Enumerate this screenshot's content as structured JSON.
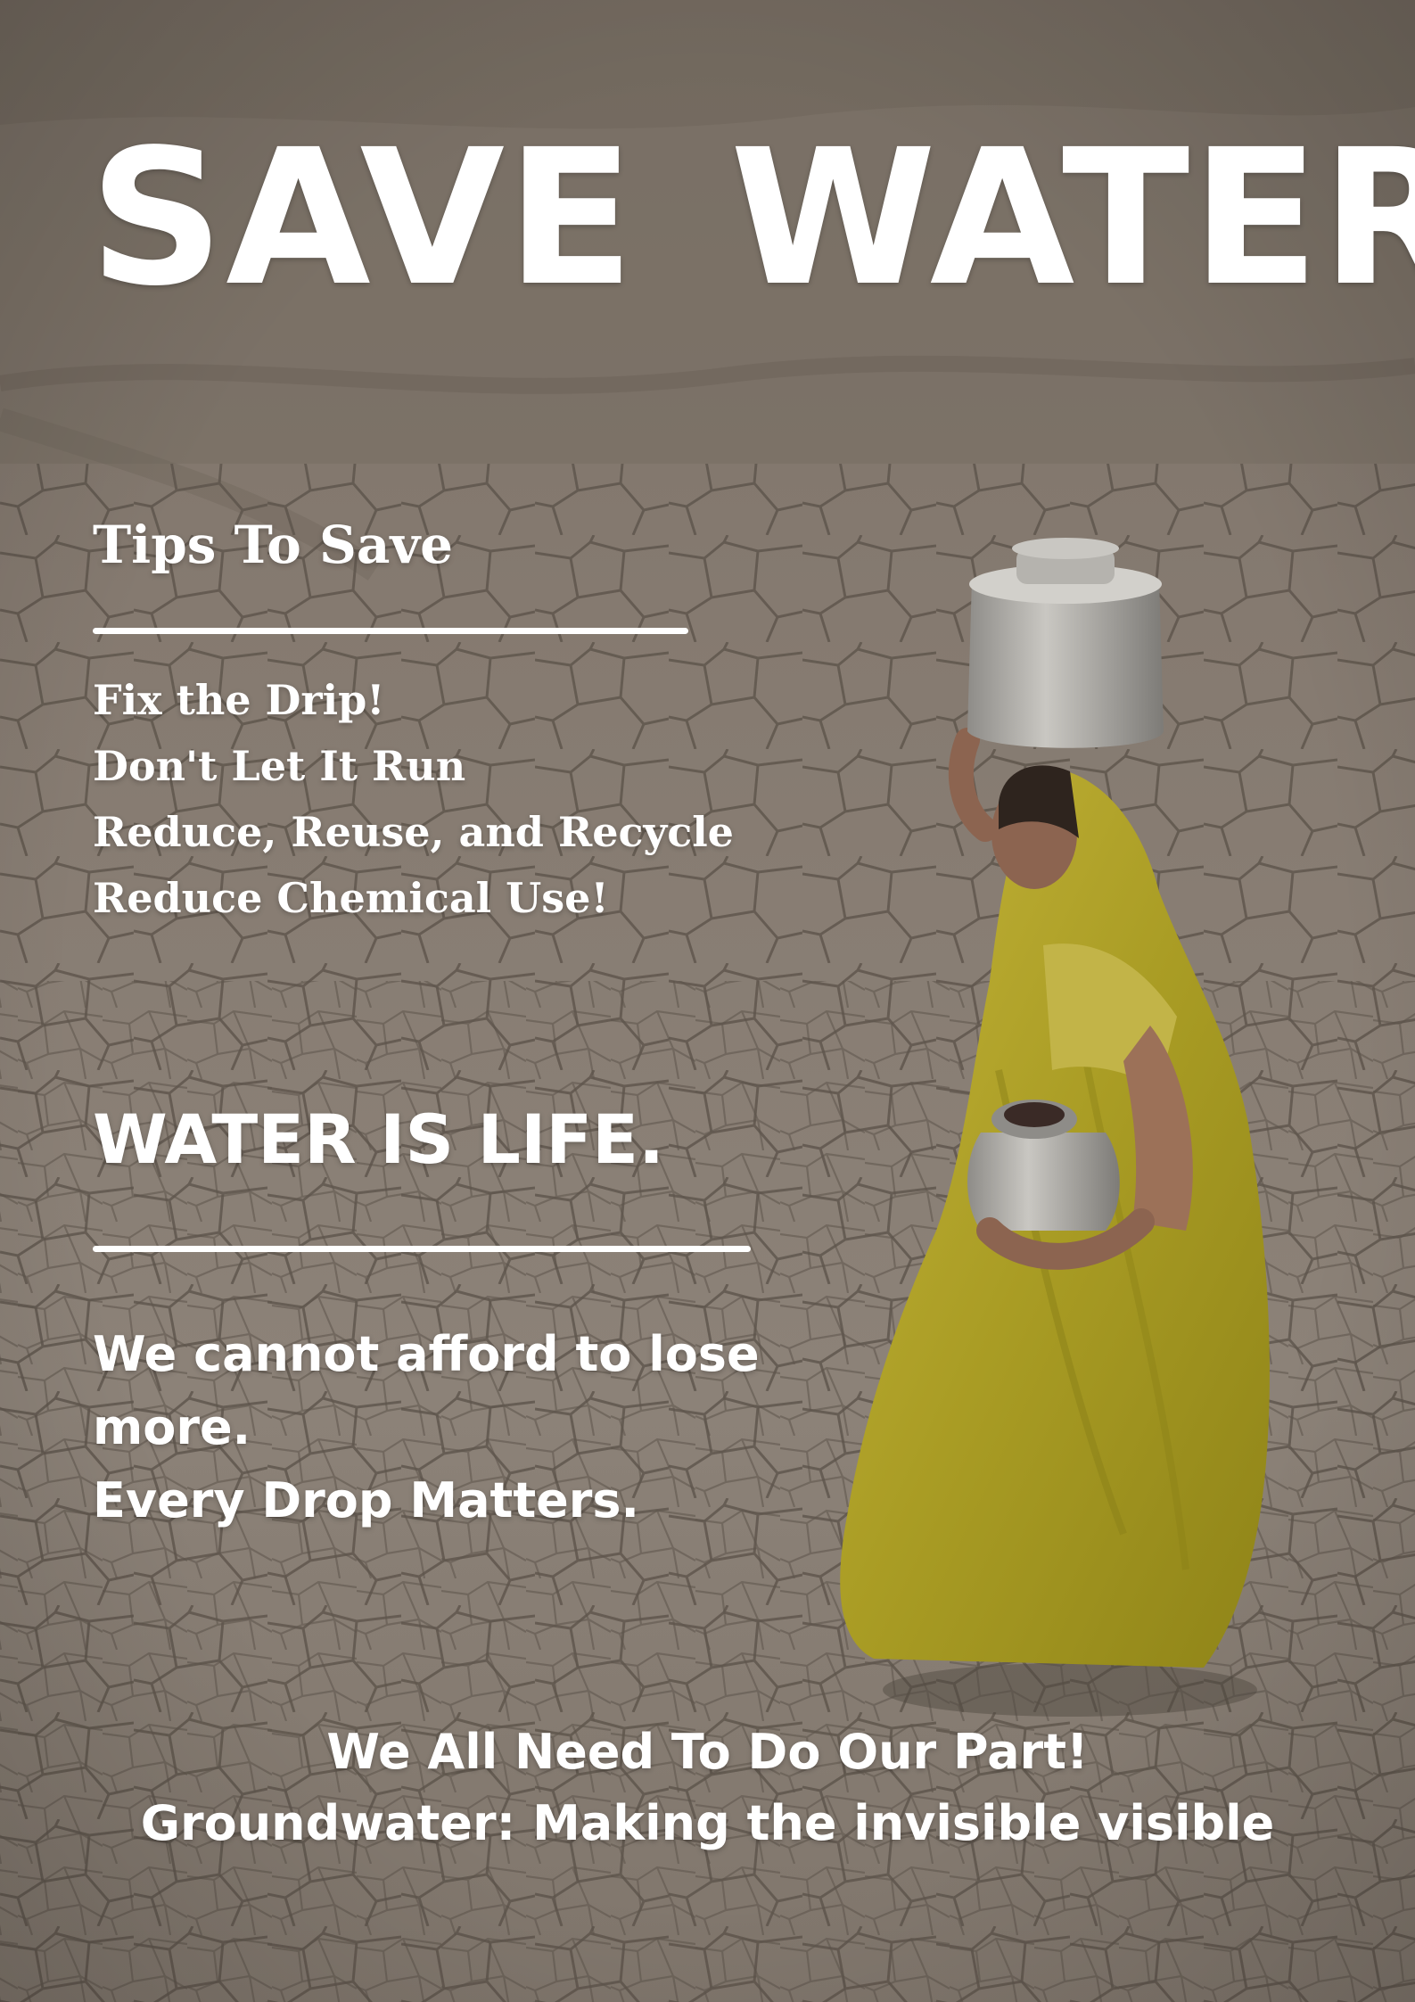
{
  "poster": {
    "title": "SAVE  WATER",
    "tips_heading": "Tips To Save",
    "tips": [
      "Fix the Drip!",
      "Don't Let It Run",
      "Reduce, Reuse, and Recycle",
      "Reduce Chemical Use!"
    ],
    "slogan_heading": "WATER IS LIFE.",
    "message_line_1": "We cannot afford to lose more.",
    "message_line_2": "Every Drop Matters.",
    "footer_line_1": "We All Need To Do Our  Part!",
    "footer_line_2": "Groundwater: Making the invisible visible"
  },
  "colors": {
    "text": "#ffffff",
    "ground": "#8a8076",
    "sari": "#b5a828",
    "pot": "#a9a7a3"
  }
}
